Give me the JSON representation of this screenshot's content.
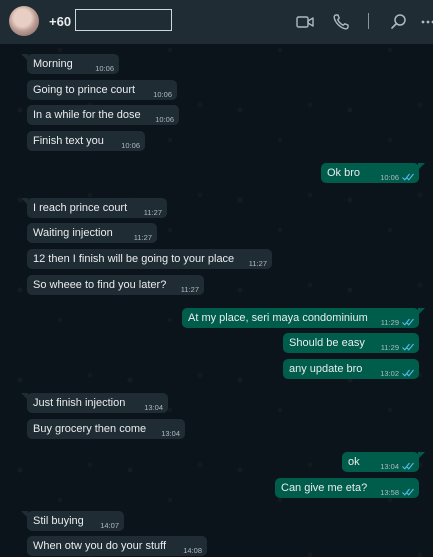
{
  "header": {
    "contact_name": "+60",
    "icons": [
      "video-call-icon",
      "voice-call-icon",
      "search-icon",
      "menu-icon"
    ]
  },
  "colors": {
    "background": "#0b141a",
    "header": "#202c33",
    "incoming_bubble": "#202c33",
    "outgoing_bubble": "#005c4b",
    "read_tick": "#53bdeb",
    "text": "#e9edef",
    "timestamp": "#aebac1"
  },
  "messages": [
    {
      "direction": "in",
      "text": "Morning",
      "time": "10:06"
    },
    {
      "direction": "in",
      "text": "Going to prince court",
      "time": "10:06"
    },
    {
      "direction": "in",
      "text": "In a while for the dose",
      "time": "10:06"
    },
    {
      "direction": "in",
      "text": "Finish text you",
      "time": "10:06"
    },
    {
      "direction": "out",
      "text": "Ok bro",
      "time": "10:06",
      "status": "read"
    },
    {
      "direction": "in",
      "text": "I reach prince court",
      "time": "11:27"
    },
    {
      "direction": "in",
      "text": "Waiting injection",
      "time": "11:27"
    },
    {
      "direction": "in",
      "text": "12 then I finish will be going to your place",
      "time": "11:27"
    },
    {
      "direction": "in",
      "text": "So wheee to find you later?",
      "time": "11:27"
    },
    {
      "direction": "out",
      "text": "At my place, seri maya condominium",
      "time": "11:29",
      "status": "read"
    },
    {
      "direction": "out",
      "text": "Should be easy",
      "time": "11:29",
      "status": "read"
    },
    {
      "direction": "out",
      "text": "any update bro",
      "time": "13:02",
      "status": "read"
    },
    {
      "direction": "in",
      "text": "Just finish injection",
      "time": "13:04"
    },
    {
      "direction": "in",
      "text": "Buy grocery then come",
      "time": "13:04"
    },
    {
      "direction": "out",
      "text": "ok",
      "time": "13:04",
      "status": "read"
    },
    {
      "direction": "out",
      "text": "Can give me eta?",
      "time": "13:58",
      "status": "read"
    },
    {
      "direction": "in",
      "text": "Stil buying",
      "time": "14:07"
    },
    {
      "direction": "in",
      "text": "When otw you do your stuff",
      "time": "14:08"
    }
  ]
}
